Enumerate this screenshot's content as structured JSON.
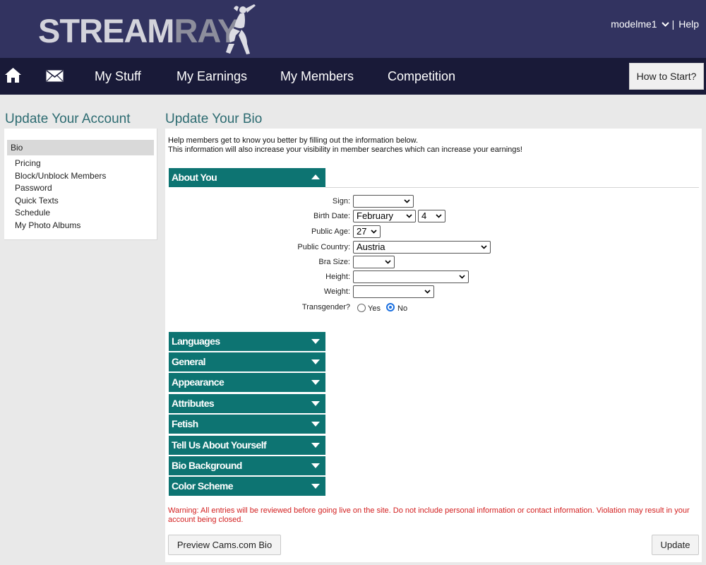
{
  "header": {
    "logo_main": "STREAM",
    "logo_accent": "RAY",
    "username": "modelme1",
    "separator": "|",
    "help": "Help"
  },
  "nav": {
    "items": [
      "My Stuff",
      "My Earnings",
      "My Members",
      "Competition"
    ],
    "how_to_start": "How to Start?"
  },
  "sidebar": {
    "title": "Update Your Account",
    "items": [
      "Bio",
      "Pricing",
      "Block/Unblock Members",
      "Password",
      "Quick Texts",
      "Schedule",
      "My Photo Albums"
    ],
    "active": "Bio"
  },
  "main": {
    "title": "Update Your Bio",
    "intro_line1": "Help members get to know you better by filling out the information below.",
    "intro_line2": "This information will also increase your visibility in member searches which can increase your earnings!",
    "about_section": "About You",
    "fields": {
      "sign": {
        "label": "Sign:",
        "value": ""
      },
      "birth_date": {
        "label": "Birth Date:",
        "month": "February",
        "day": "4"
      },
      "public_age": {
        "label": "Public Age:",
        "value": "27"
      },
      "public_country": {
        "label": "Public Country:",
        "value": "Austria"
      },
      "bra_size": {
        "label": "Bra Size:",
        "value": ""
      },
      "height": {
        "label": "Height:",
        "value": ""
      },
      "weight": {
        "label": "Weight:",
        "value": ""
      },
      "transgender": {
        "label": "Transgender?",
        "options": [
          "Yes",
          "No"
        ],
        "selected": "No"
      }
    },
    "sections": [
      "Languages",
      "General",
      "Appearance",
      "Attributes",
      "Fetish",
      "Tell Us About Yourself",
      "Bio Background",
      "Color Scheme"
    ],
    "warning": "Warning: All entries will be reviewed before going live on the site. Do not include personal information or contact information. Violation may result in your account being closed.",
    "preview_button": "Preview Cams.com Bio",
    "update_button": "Update"
  },
  "colors": {
    "header_bg": "#323360",
    "nav_bg": "#191a38",
    "accent_teal": "#0d7472",
    "title_teal": "#2e6c72",
    "warning_red": "#d32020"
  },
  "icons": [
    "home-icon",
    "mail-icon",
    "chevron-down-icon",
    "logo-figure"
  ]
}
